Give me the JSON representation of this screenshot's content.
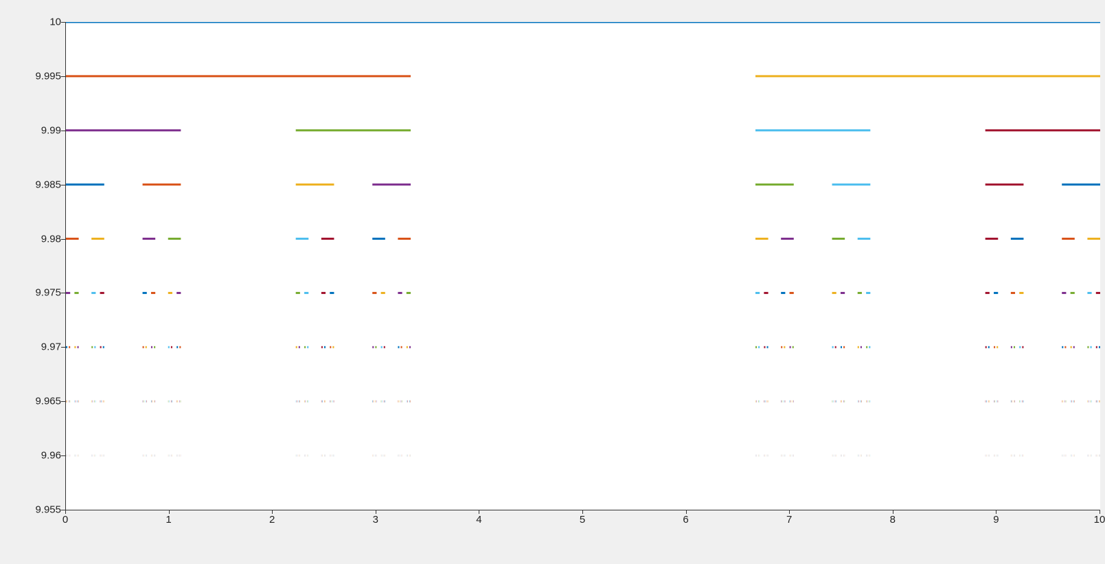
{
  "chart_data": {
    "type": "line",
    "xlim": [
      0,
      10
    ],
    "ylim": [
      9.955,
      10
    ],
    "xticks": [
      0,
      1,
      2,
      3,
      4,
      5,
      6,
      7,
      8,
      9,
      10
    ],
    "yticks": [
      9.955,
      9.96,
      9.965,
      9.97,
      9.975,
      9.98,
      9.985,
      9.99,
      9.995,
      10
    ],
    "colors": [
      "#0072BD",
      "#D95319",
      "#EDB120",
      "#7E2F8E",
      "#77AC30",
      "#4DBEEE",
      "#A2142F"
    ],
    "levels": [
      {
        "y": 10.0,
        "segments": [
          [
            0,
            10
          ]
        ]
      },
      {
        "y": 9.995,
        "segments": [
          [
            0,
            3.333
          ],
          [
            6.667,
            10
          ]
        ]
      },
      {
        "y": 9.99,
        "segments": [
          [
            0,
            1.111
          ],
          [
            2.222,
            3.333
          ],
          [
            6.667,
            7.778
          ],
          [
            8.889,
            10
          ]
        ]
      },
      {
        "y": 9.985,
        "segments": [
          [
            0,
            0.37
          ],
          [
            0.741,
            1.111
          ],
          [
            2.222,
            2.593
          ],
          [
            2.963,
            3.333
          ],
          [
            6.667,
            7.037
          ],
          [
            7.407,
            7.778
          ],
          [
            8.889,
            9.259
          ],
          [
            9.63,
            10
          ]
        ]
      },
      {
        "y": 9.98,
        "segments": "auto16"
      },
      {
        "y": 9.975,
        "segments": "auto32"
      },
      {
        "y": 9.97,
        "segments": "auto64"
      },
      {
        "y": 9.965,
        "segments": "auto128"
      },
      {
        "y": 9.96,
        "segments": "auto256"
      }
    ],
    "note": "Cantor-set / ternary fractal: at each level y=10-0.005*k, each segment of level k-1 splits into its outer thirds, drawn in MATLAB default color order cycling, with opacity fading at lower levels."
  }
}
